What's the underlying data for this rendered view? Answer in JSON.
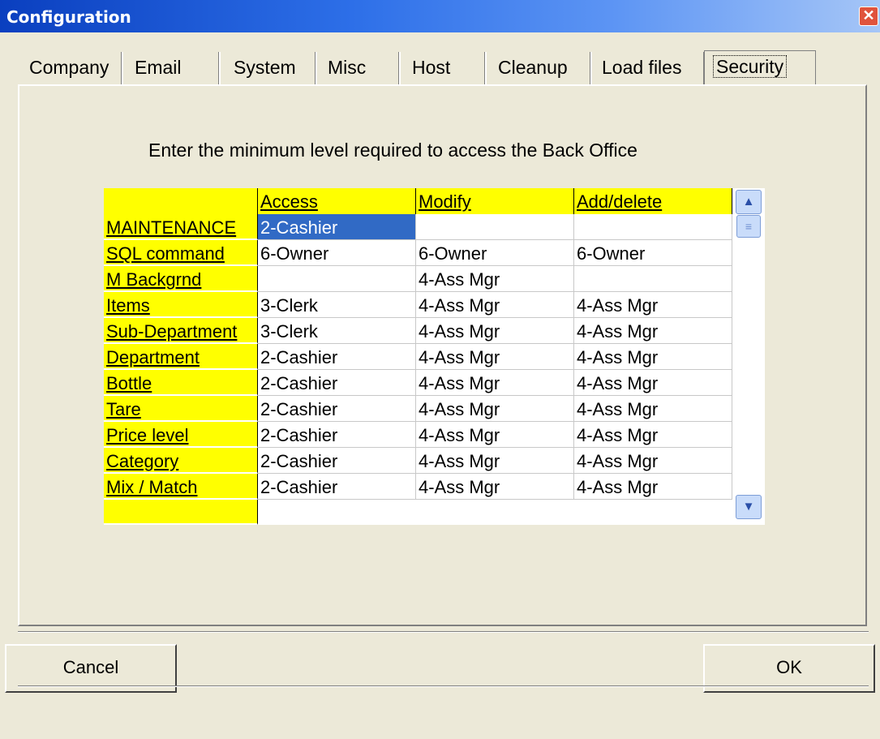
{
  "window": {
    "title": "Configuration",
    "close_label": "✕"
  },
  "tabs": [
    {
      "label": "Company",
      "selected": false
    },
    {
      "label": "Email",
      "selected": false
    },
    {
      "label": "System",
      "selected": false
    },
    {
      "label": "Misc",
      "selected": false
    },
    {
      "label": "Host",
      "selected": false
    },
    {
      "label": "Cleanup",
      "selected": false
    },
    {
      "label": "Load files",
      "selected": false
    },
    {
      "label": "Security",
      "selected": true
    }
  ],
  "instruction": "Enter the minimum level required to access the Back Office",
  "grid": {
    "columns": [
      "Access",
      "Modify",
      "Add/delete"
    ],
    "rows": [
      {
        "name": "MAINTENANCE",
        "access": "2-Cashier",
        "modify": "",
        "add_delete": ""
      },
      {
        "name": "SQL command",
        "access": "6-Owner",
        "modify": "6-Owner",
        "add_delete": "6-Owner"
      },
      {
        "name": "M Backgrnd",
        "access": "",
        "modify": "4-Ass Mgr",
        "add_delete": ""
      },
      {
        "name": "Items",
        "access": "3-Clerk",
        "modify": "4-Ass Mgr",
        "add_delete": "4-Ass Mgr"
      },
      {
        "name": "Sub-Department",
        "access": "3-Clerk",
        "modify": "4-Ass Mgr",
        "add_delete": "4-Ass Mgr"
      },
      {
        "name": "Department",
        "access": "2-Cashier",
        "modify": "4-Ass Mgr",
        "add_delete": "4-Ass Mgr"
      },
      {
        "name": "Bottle",
        "access": "2-Cashier",
        "modify": "4-Ass Mgr",
        "add_delete": "4-Ass Mgr"
      },
      {
        "name": "Tare",
        "access": "2-Cashier",
        "modify": "4-Ass Mgr",
        "add_delete": "4-Ass Mgr"
      },
      {
        "name": "Price level",
        "access": "2-Cashier",
        "modify": "4-Ass Mgr",
        "add_delete": "4-Ass Mgr"
      },
      {
        "name": "Category",
        "access": "2-Cashier",
        "modify": "4-Ass Mgr",
        "add_delete": "4-Ass Mgr"
      },
      {
        "name": "Mix / Match",
        "access": "2-Cashier",
        "modify": "4-Ass Mgr",
        "add_delete": "4-Ass Mgr"
      }
    ],
    "selected_row": 0,
    "selected_column": "access"
  },
  "scrollbar": {
    "up_icon": "▲",
    "down_icon": "▼",
    "thumb_icon": "≡"
  },
  "buttons": {
    "cancel": "Cancel",
    "ok": "OK"
  },
  "colors": {
    "header_bg": "#ffff00",
    "selection_bg": "#316ac5",
    "titlebar": "#0a3fbf"
  }
}
